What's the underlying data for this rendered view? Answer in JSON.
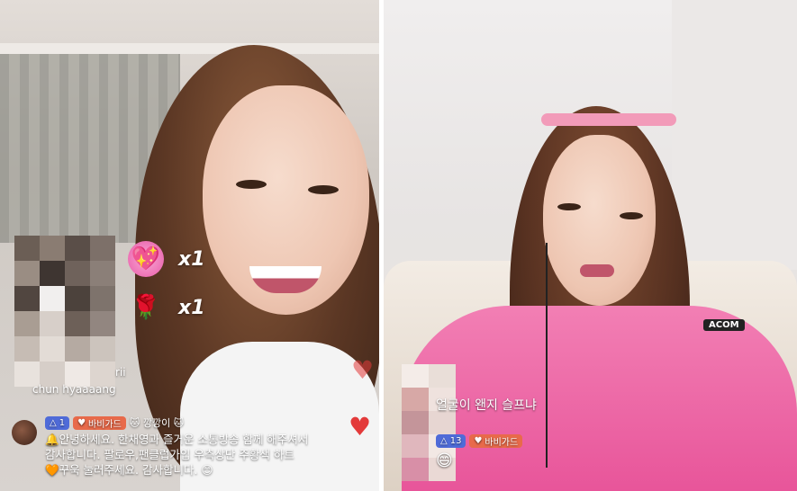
{
  "left": {
    "gifts": [
      {
        "icon": "heart-face-gift-icon",
        "glyph": "💖",
        "count": "x1"
      },
      {
        "icon": "rose-gift-icon",
        "glyph": "🌹",
        "count": "x1"
      }
    ],
    "commenters": [
      "rii",
      "chun hyaaaang"
    ],
    "host_message": {
      "level_badge": "1",
      "fan_badge": "바비가드",
      "name_tag": "깡깡이",
      "line1": "안녕하세요. 한채영과 즐거운 소통방송 함께 해주셔서",
      "line2": "감사합니다. 팔로우,팬클럽가입 우측상단 주황색 하트",
      "line3": "꾸욱 눌러주세요. 감사합니다."
    },
    "colors": {
      "heart": "#e33a3a",
      "level_badge": "#4f6bd8",
      "fan_badge": "#e86a4a"
    }
  },
  "right": {
    "chat": "얼굴이 왠지 슬프냐",
    "level_badge": "13",
    "fan_badge": "바비가드",
    "emoji": "😄",
    "jacket_text": "ACOM"
  }
}
